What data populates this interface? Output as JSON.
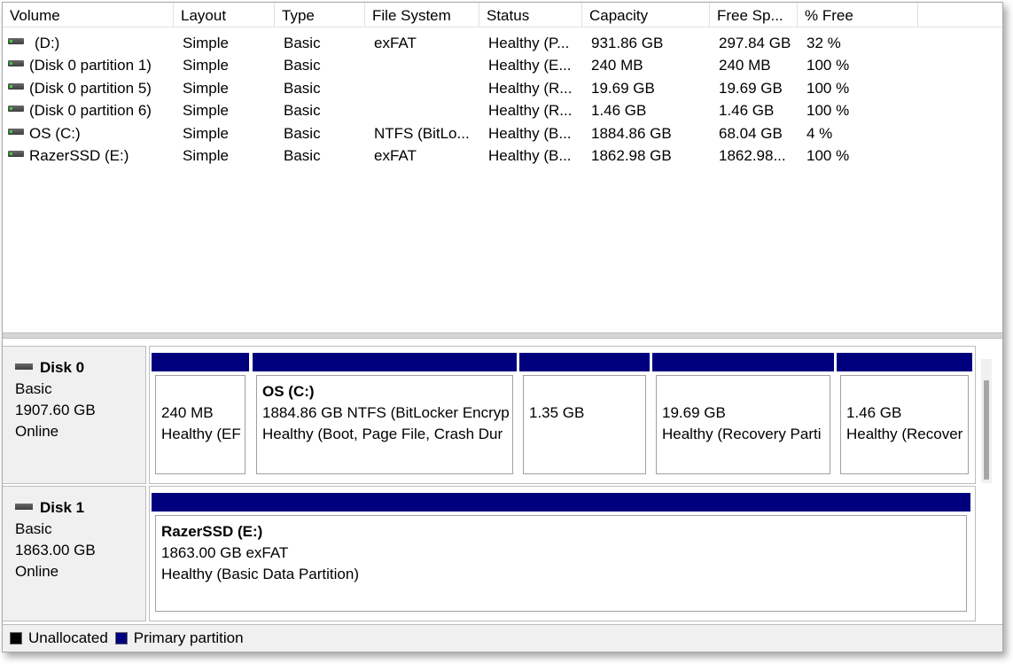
{
  "volume_list": {
    "columns": [
      "Volume",
      "Layout",
      "Type",
      "File System",
      "Status",
      "Capacity",
      "Free Sp...",
      "% Free"
    ],
    "rows": [
      {
        "volume": "(D:)",
        "layout": "Simple",
        "type": "Basic",
        "fs": "exFAT",
        "status": "Healthy (P...",
        "capacity": "931.86 GB",
        "free": "297.84 GB",
        "pct": "32 %"
      },
      {
        "volume": "(Disk 0 partition 1)",
        "layout": "Simple",
        "type": "Basic",
        "fs": "",
        "status": "Healthy (E...",
        "capacity": "240 MB",
        "free": "240 MB",
        "pct": "100 %"
      },
      {
        "volume": "(Disk 0 partition 5)",
        "layout": "Simple",
        "type": "Basic",
        "fs": "",
        "status": "Healthy (R...",
        "capacity": "19.69 GB",
        "free": "19.69 GB",
        "pct": "100 %"
      },
      {
        "volume": "(Disk 0 partition 6)",
        "layout": "Simple",
        "type": "Basic",
        "fs": "",
        "status": "Healthy (R...",
        "capacity": "1.46 GB",
        "free": "1.46 GB",
        "pct": "100 %"
      },
      {
        "volume": "OS (C:)",
        "layout": "Simple",
        "type": "Basic",
        "fs": "NTFS (BitLo...",
        "status": "Healthy (B...",
        "capacity": "1884.86 GB",
        "free": "68.04 GB",
        "pct": "4 %"
      },
      {
        "volume": "RazerSSD (E:)",
        "layout": "Simple",
        "type": "Basic",
        "fs": "exFAT",
        "status": "Healthy (B...",
        "capacity": "1862.98 GB",
        "free": "1862.98...",
        "pct": "100 %"
      }
    ]
  },
  "disks": [
    {
      "name": "Disk 0",
      "kind": "Basic",
      "size": "1907.60 GB",
      "state": "Online",
      "partitions": [
        {
          "name": "",
          "line1": "240 MB",
          "line2": "Healthy (EF"
        },
        {
          "name": "OS  (C:)",
          "line1": "1884.86 GB NTFS (BitLocker Encryp",
          "line2": "Healthy (Boot, Page File, Crash Dur"
        },
        {
          "name": "",
          "line1": "1.35 GB",
          "line2": ""
        },
        {
          "name": "",
          "line1": "19.69 GB",
          "line2": "Healthy (Recovery Parti"
        },
        {
          "name": "",
          "line1": "1.46 GB",
          "line2": "Healthy (Recover"
        }
      ]
    },
    {
      "name": "Disk 1",
      "kind": "Basic",
      "size": "1863.00 GB",
      "state": "Online",
      "partitions": [
        {
          "name": "RazerSSD  (E:)",
          "line1": "1863.00 GB exFAT",
          "line2": "Healthy (Basic Data Partition)"
        }
      ]
    }
  ],
  "legend": {
    "unallocated": "Unallocated",
    "primary": "Primary partition",
    "unallocated_color": "#000000",
    "primary_color": "#00007f"
  },
  "icons": {
    "drive": "drive-icon",
    "disk": "disk-icon"
  }
}
